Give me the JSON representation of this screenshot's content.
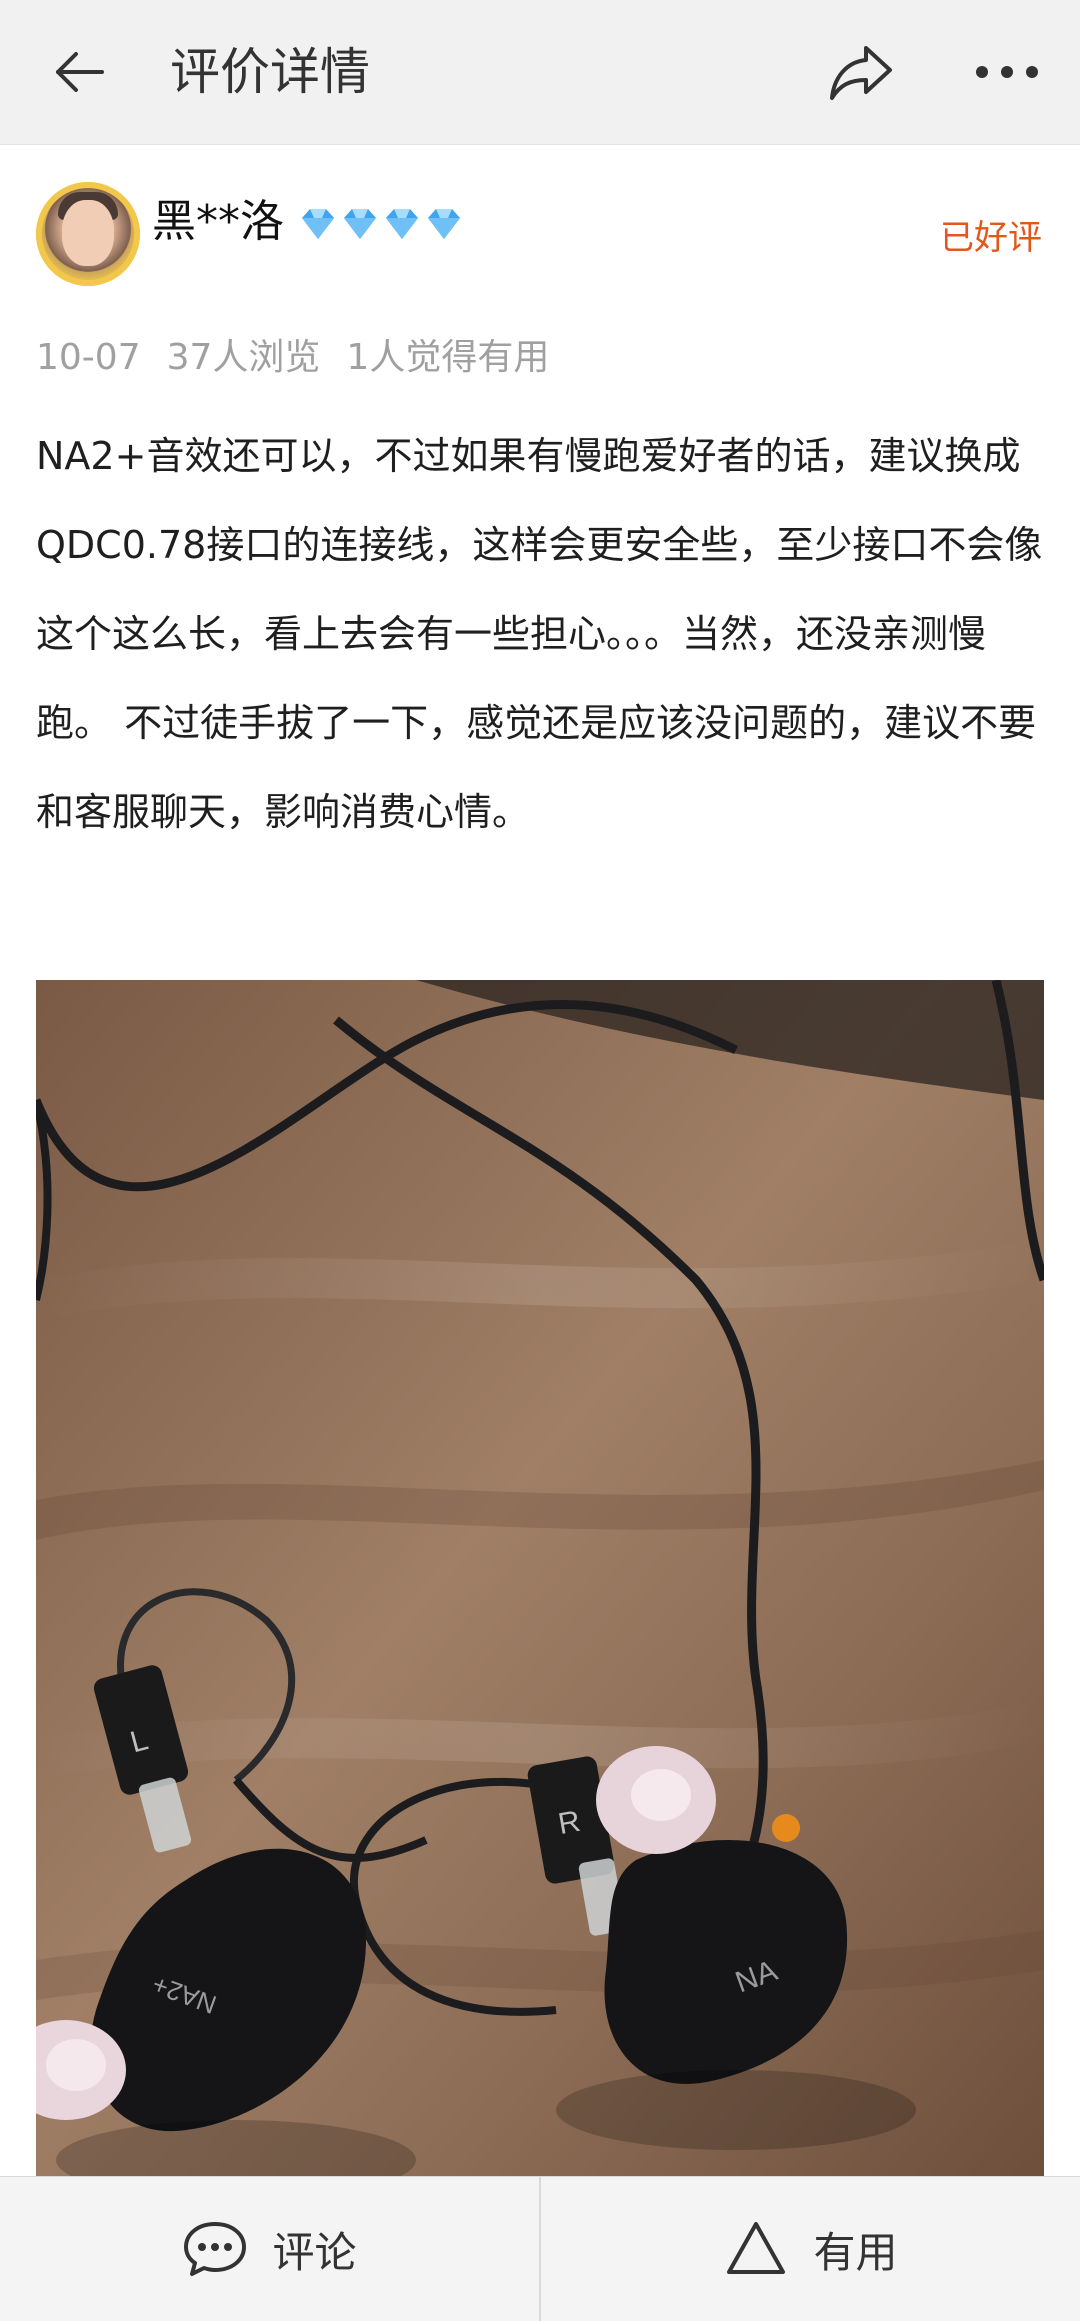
{
  "header": {
    "title": "评价详情",
    "back_icon": "arrow-left-icon",
    "share_icon": "share-icon",
    "more_icon": "more-dots-icon"
  },
  "user": {
    "name": "黑**洛",
    "level_icon": "diamond-icon",
    "level_count": 4,
    "level_color": "#4aa8f0",
    "rating_badge": "已好评",
    "rating_badge_color": "#e4561a"
  },
  "meta": {
    "date": "10-07",
    "views": "37人浏览",
    "helpful_count": "1人觉得有用"
  },
  "review": {
    "text": "NA2+音效还可以，不过如果有慢跑爱好者的话，建议换成QDC0.78接口的连接线，这样会更安全些，至少接口不会像这个这么长，看上去会有一些担心。。。当然，还没亲测慢跑。 不过徒手拔了一下，感觉还是应该没问题的，建议不要和客服聊天，影响消费心情。"
  },
  "photo": {
    "earbud_left_text": "NA2+",
    "earbud_right_text": "NA",
    "cable_tag_left": "L",
    "cable_tag_right": "R"
  },
  "footer": {
    "comment_label": "评论",
    "comment_icon": "chat-bubble-icon",
    "useful_label": "有用",
    "useful_icon": "triangle-icon"
  }
}
